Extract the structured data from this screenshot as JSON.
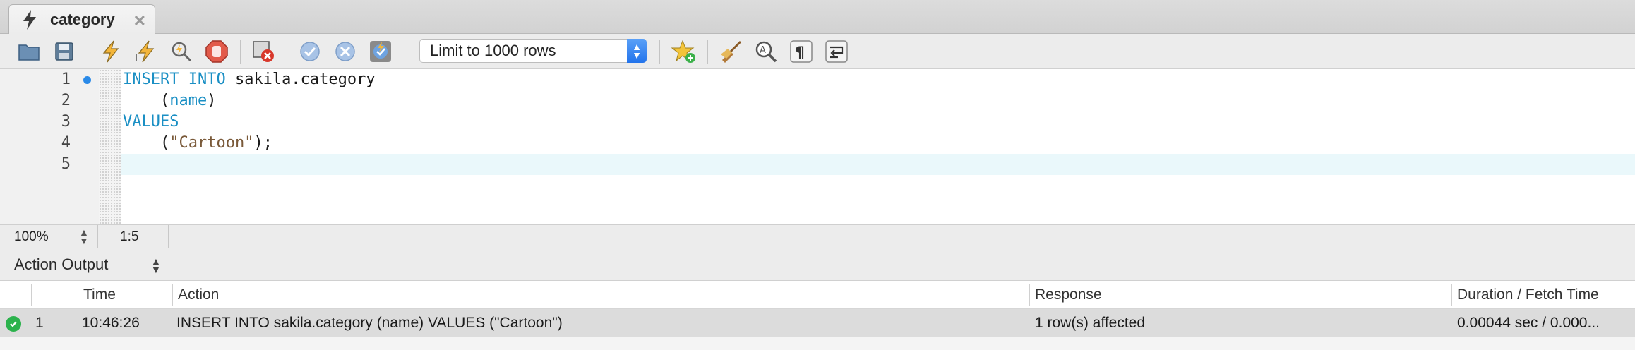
{
  "tab": {
    "label": "category",
    "close_glyph": "✕",
    "icon": "lightning-bolt-icon"
  },
  "toolbar": {
    "limit_select": {
      "value": "Limit to 1000 rows"
    },
    "icons": [
      "open-file-icon",
      "save-icon",
      "execute-icon",
      "execute-current-icon",
      "explain-icon",
      "stop-icon",
      "toggle-error-stop-icon",
      "commit-icon",
      "rollback-icon",
      "autocommit-icon",
      "add-snippet-icon",
      "beautify-icon",
      "find-icon",
      "invisible-chars-icon",
      "wrap-lines-icon"
    ]
  },
  "editor": {
    "line_numbers": [
      "1",
      "2",
      "3",
      "4",
      "5"
    ],
    "lines": [
      {
        "kw": "INSERT INTO",
        "rest": " sakila.category"
      },
      {
        "indent": "    (",
        "kw": "name",
        "rest": ")"
      },
      {
        "kw": "VALUES",
        "rest": ""
      },
      {
        "indent": "    (",
        "str": "\"Cartoon\"",
        "rest": ");"
      },
      {
        "rest": ""
      }
    ]
  },
  "statusbar": {
    "zoom": "100%",
    "cursor_position": "1:5"
  },
  "output": {
    "title": "Action Output",
    "columns": [
      "Time",
      "Action",
      "Response",
      "Duration / Fetch Time"
    ],
    "rows": [
      {
        "index": "1",
        "time": "10:46:26",
        "action": "INSERT INTO sakila.category  (name) VALUES  (\"Cartoon\")",
        "response": "1 row(s) affected",
        "duration": "0.00044 sec / 0.000..."
      }
    ]
  },
  "colors": {
    "keyword": "#1a8fc4",
    "string": "#7a5a3a",
    "accent": "#2374ec",
    "success": "#2bb24c"
  }
}
